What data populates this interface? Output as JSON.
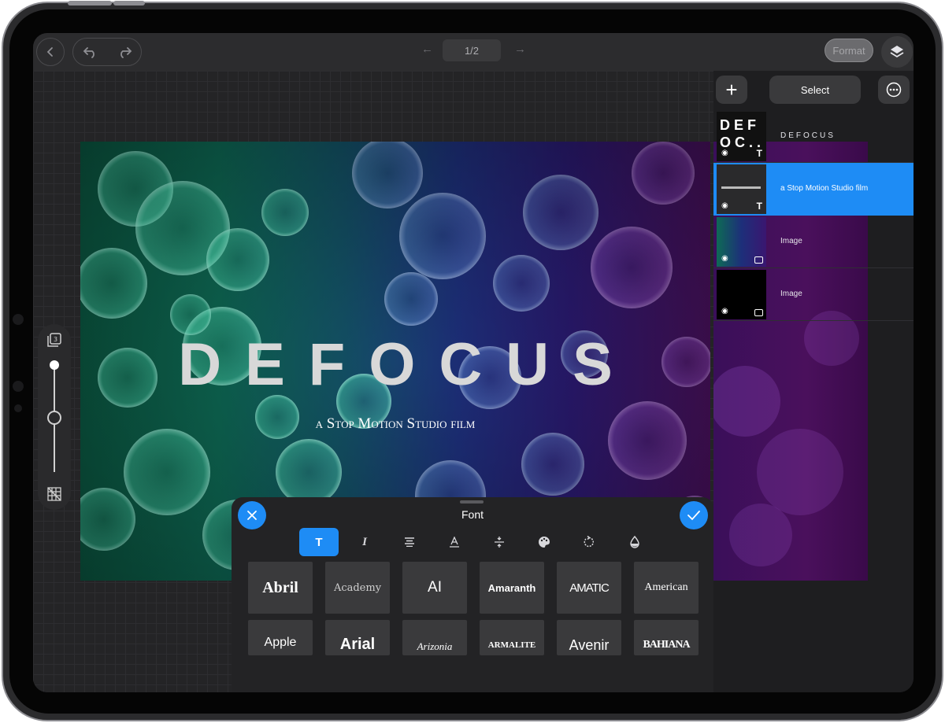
{
  "toolbar": {
    "page_indicator": "1/2",
    "format_label": "Format"
  },
  "canvas": {
    "title": "DEFOCUS",
    "subtitle": "a Stop Motion Studio film"
  },
  "layers_panel": {
    "add_label": "+",
    "select_label": "Select",
    "layers": [
      {
        "name": "DEFOCUS",
        "type": "text",
        "selected": false,
        "thumb_text": "DEF\nOC.."
      },
      {
        "name": "a Stop Motion Studio film",
        "type": "text",
        "selected": true
      },
      {
        "name": "Image",
        "type": "image",
        "selected": false
      },
      {
        "name": "Image",
        "type": "image",
        "selected": false
      }
    ]
  },
  "font_sheet": {
    "title": "Font",
    "tools": [
      "text-icon",
      "italic-icon",
      "align-icon",
      "underline-icon",
      "spacing-icon",
      "palette-icon",
      "rotate-icon",
      "opacity-icon"
    ],
    "fonts_row1": [
      "Abril",
      "Academy",
      "AI",
      "Amaranth",
      "AMATIC",
      "American"
    ],
    "fonts_row2": [
      "Apple",
      "Arial",
      "Arizonia",
      "ARMALITE",
      "Avenir",
      "BAHIANA"
    ]
  },
  "colors": {
    "accent": "#1e8cf5",
    "panel": "#2c2c2e"
  }
}
